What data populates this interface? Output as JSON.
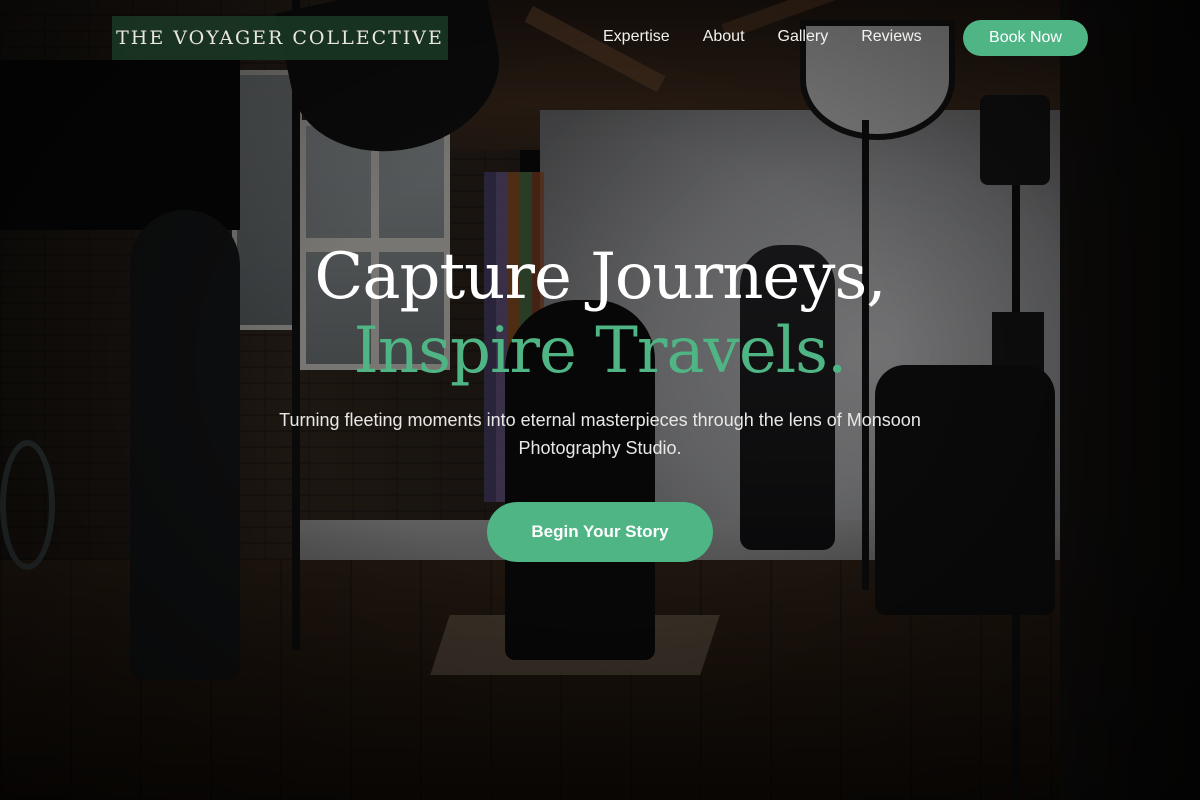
{
  "nav": {
    "logo": "THE VOYAGER COLLECTIVE",
    "links": [
      "Expertise",
      "About",
      "Gallery",
      "Reviews"
    ],
    "cta": "Book Now"
  },
  "hero": {
    "title_line1": "Capture Journeys,",
    "title_line2": "Inspire Travels.",
    "subtitle": "Turning fleeting moments into eternal masterpieces through the lens of Monsoon Photography Studio.",
    "cta": "Begin Your Story"
  },
  "colors": {
    "accent": "#4fb585",
    "logo_bg": "#1a3826",
    "text": "#ffffff"
  }
}
